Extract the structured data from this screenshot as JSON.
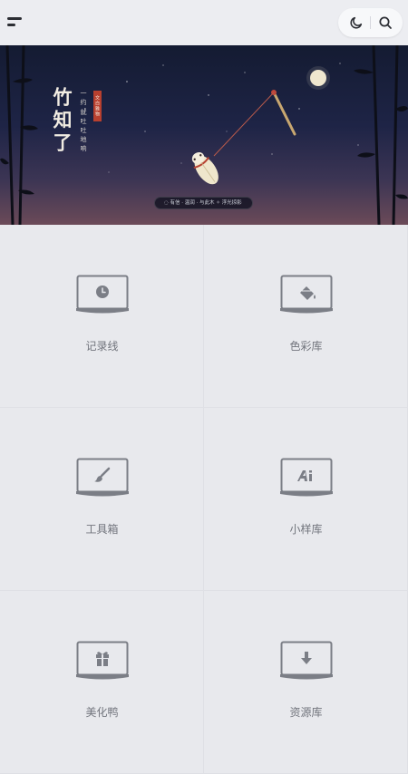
{
  "header": {
    "menu_icon": "menu-icon",
    "moon_icon": "moon-icon",
    "search_icon": "search-icon"
  },
  "banner": {
    "title": "竹知了",
    "poem_line_1": "一约，",
    "poem_line_2": "就吐吐地响",
    "seal_text": "文白雅物",
    "caption": "◌ 有信 · 温润 · 与此木 ✧ 浮光掠影"
  },
  "grid": {
    "items": [
      {
        "label": "记录线",
        "icon": "clock-icon"
      },
      {
        "label": "色彩库",
        "icon": "paint-bucket-icon"
      },
      {
        "label": "工具箱",
        "icon": "brush-icon"
      },
      {
        "label": "小样库",
        "icon": "ai-icon"
      },
      {
        "label": "美化鸭",
        "icon": "gift-icon"
      },
      {
        "label": "资源库",
        "icon": "download-icon"
      }
    ]
  },
  "colors": {
    "background": "#e8e9ed",
    "icon": "#7b7e86",
    "text": "#72757d"
  }
}
